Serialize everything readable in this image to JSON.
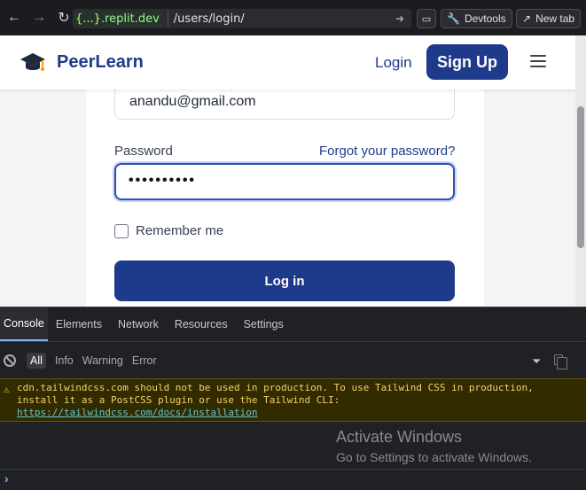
{
  "browser": {
    "back_icon": "arrow-left-icon",
    "forward_icon": "arrow-right-icon",
    "reload_icon": "reload-icon",
    "url_domain_prefix": "{...}",
    "url_domain_suffix": ".replit.dev",
    "url_path": "/users/login/",
    "devtools_label": "Devtools",
    "new_tab_label": "New tab"
  },
  "header": {
    "logo_icon": "graduation-cap-icon",
    "brand": "PeerLearn",
    "login_label": "Login",
    "signup_label": "Sign Up",
    "menu_icon": "hamburger-icon"
  },
  "form": {
    "email_value": "anandu@gmail.com",
    "password_label": "Password",
    "forgot_label": "Forgot your password?",
    "password_value": "••••••••••",
    "remember_label": "Remember me",
    "remember_checked": false,
    "submit_label": "Log in"
  },
  "devtools": {
    "tabs": [
      "Console",
      "Elements",
      "Network",
      "Resources",
      "Settings"
    ],
    "active_tab": "Console",
    "levels": [
      "All",
      "Info",
      "Warning",
      "Error"
    ],
    "active_level": "All",
    "warning_line1": "cdn.tailwindcss.com should not be used in production. To use Tailwind CSS in production,",
    "warning_line2": "install it as a PostCSS plugin or use the Tailwind CLI:",
    "warning_link": "https://tailwindcss.com/docs/installation",
    "prompt_symbol": "›"
  },
  "watermark": {
    "title": "Activate Windows",
    "subtitle": "Go to Settings to activate Windows."
  },
  "colors": {
    "brand_primary": "#1e3a8a",
    "devtools_bg": "#202124",
    "warning_bg": "#332b00",
    "warning_text": "#f2d06b"
  }
}
